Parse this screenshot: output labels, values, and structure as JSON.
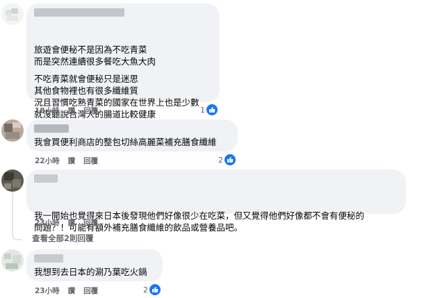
{
  "comments": [
    {
      "lines": [
        "旅遊會便秘不是因為不吃青菜",
        "而是突然連續很多餐吃大魚大肉",
        "",
        "不吃青菜就會便秘只是迷思",
        "其他食物裡也有很多纖維質",
        "況且習慣吃熟青菜的國家在世界上也是少數",
        "就沒聽說台灣人的腸道比較健康"
      ],
      "time": "18小時",
      "like_label": "讚",
      "reply_label": "回覆",
      "reaction_count": "1"
    },
    {
      "lines": [
        "我會買便利商店的整包切絲高麗菜補充膳食纖維"
      ],
      "time": "22小時",
      "like_label": "讚",
      "reply_label": "回覆",
      "reaction_count": "2"
    },
    {
      "lines": [
        "我一開始也覺得來日本後發現他們好像很少在吃菜，但又覺得他們好像都不會有便秘的",
        "問題？！可能有額外補充膳食纖維的飲品或營養品吧。"
      ],
      "time": "23小時",
      "like_label": "讚",
      "reply_label": "回覆",
      "reaction_count": ""
    },
    {
      "lines": [
        "我想到去日本的涮乃葉吃火鍋"
      ],
      "time": "23小時",
      "like_label": "讚",
      "reply_label": "回覆",
      "reaction_count": "2"
    }
  ],
  "view_replies": "查看全部2則回覆",
  "icons": {
    "reaction": "thumbs-up-icon"
  },
  "colors": {
    "bubble": "#f0f2f5",
    "like_blue": "#1877f2",
    "meta": "#65676b"
  }
}
